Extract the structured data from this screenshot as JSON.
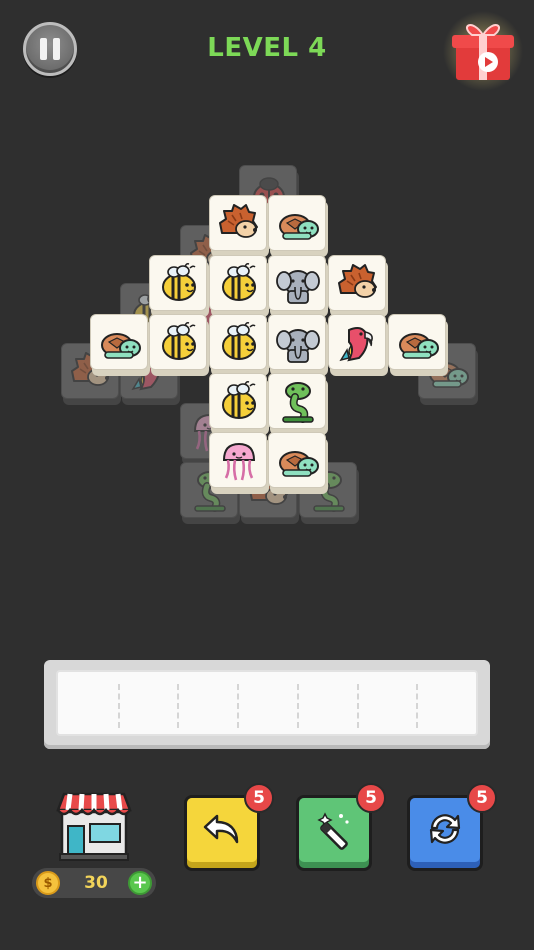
{
  "header": {
    "level_label": "LEVEL 4"
  },
  "board": {
    "tiles": [
      {
        "animal": "ladybug",
        "state": "covered"
      },
      {
        "animal": "hedgehog",
        "state": "covered"
      },
      {
        "animal": "bee",
        "state": "covered"
      },
      {
        "animal": "parrot",
        "state": "covered"
      },
      {
        "animal": "hedgehog",
        "state": "covered"
      },
      {
        "animal": "parrot",
        "state": "covered"
      },
      {
        "animal": "turtle",
        "state": "covered"
      },
      {
        "animal": "jellyfish",
        "state": "covered"
      },
      {
        "animal": "snake",
        "state": "covered"
      },
      {
        "animal": "hedgehog",
        "state": "covered"
      },
      {
        "animal": "snake",
        "state": "covered"
      },
      {
        "animal": "hedgehog",
        "state": "open"
      },
      {
        "animal": "turtle",
        "state": "open"
      },
      {
        "animal": "bee",
        "state": "open"
      },
      {
        "animal": "bee",
        "state": "open"
      },
      {
        "animal": "elephant",
        "state": "open"
      },
      {
        "animal": "hedgehog",
        "state": "open"
      },
      {
        "animal": "turtle",
        "state": "open"
      },
      {
        "animal": "bee",
        "state": "open"
      },
      {
        "animal": "bee",
        "state": "open"
      },
      {
        "animal": "elephant",
        "state": "open"
      },
      {
        "animal": "parrot",
        "state": "open"
      },
      {
        "animal": "turtle",
        "state": "open"
      },
      {
        "animal": "bee",
        "state": "open"
      },
      {
        "animal": "snake",
        "state": "open"
      },
      {
        "animal": "jellyfish",
        "state": "open"
      },
      {
        "animal": "turtle",
        "state": "open"
      }
    ]
  },
  "tray": {
    "slot_count": 7,
    "filled": []
  },
  "shop": {
    "coins": "30",
    "coin_symbol": "$",
    "add_symbol": "+"
  },
  "tools": {
    "undo": {
      "count": "5"
    },
    "hint": {
      "count": "5"
    },
    "shuffle": {
      "count": "5"
    }
  },
  "colors": {
    "background": "#2f2f2f",
    "level_text": "#7dd957",
    "badge": "#e74848",
    "undo": "#f5d63b",
    "hint": "#5fc577",
    "shuffle": "#4a8ce8"
  }
}
